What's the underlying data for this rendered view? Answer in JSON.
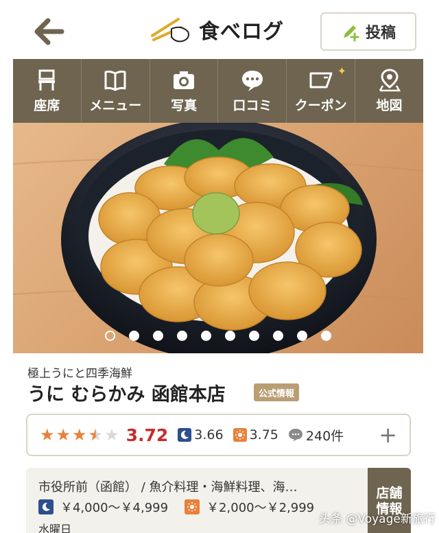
{
  "header": {
    "logo_text": "食べログ",
    "post_button_label": "投稿"
  },
  "tabs": [
    {
      "label": "座席",
      "icon": "seat-icon"
    },
    {
      "label": "メニュー",
      "icon": "book-icon"
    },
    {
      "label": "写真",
      "icon": "camera-icon"
    },
    {
      "label": "口コミ",
      "icon": "chat-bubble-icon"
    },
    {
      "label": "クーポン",
      "icon": "ticket-icon"
    },
    {
      "label": "地図",
      "icon": "map-pin-icon"
    }
  ],
  "carousel": {
    "slide_count": 10,
    "active_index": 0
  },
  "shop": {
    "subtitle": "極上うにと四季海鮮",
    "name": "うに むらかみ 函館本店",
    "official_badge": "公式情報"
  },
  "rating": {
    "stars": 3.5,
    "score": "3.72",
    "night_score": "3.66",
    "day_score": "3.75",
    "review_count": "240件",
    "plus_label": "+"
  },
  "details": {
    "area_genre": "市役所前（函館） / 魚介料理・海鮮料理、海…",
    "night_price": "￥4,000～￥4,999",
    "day_price": "￥2,000～￥2,999",
    "holiday": "水曜日",
    "store_info_button": "店舗情報"
  },
  "watermark": "头条 @Voyage新旅行",
  "colors": {
    "tab_bar": "#6e6450",
    "score_red": "#c72d2d",
    "star_orange": "#e8813a",
    "night_blue": "#2d4f8e"
  }
}
